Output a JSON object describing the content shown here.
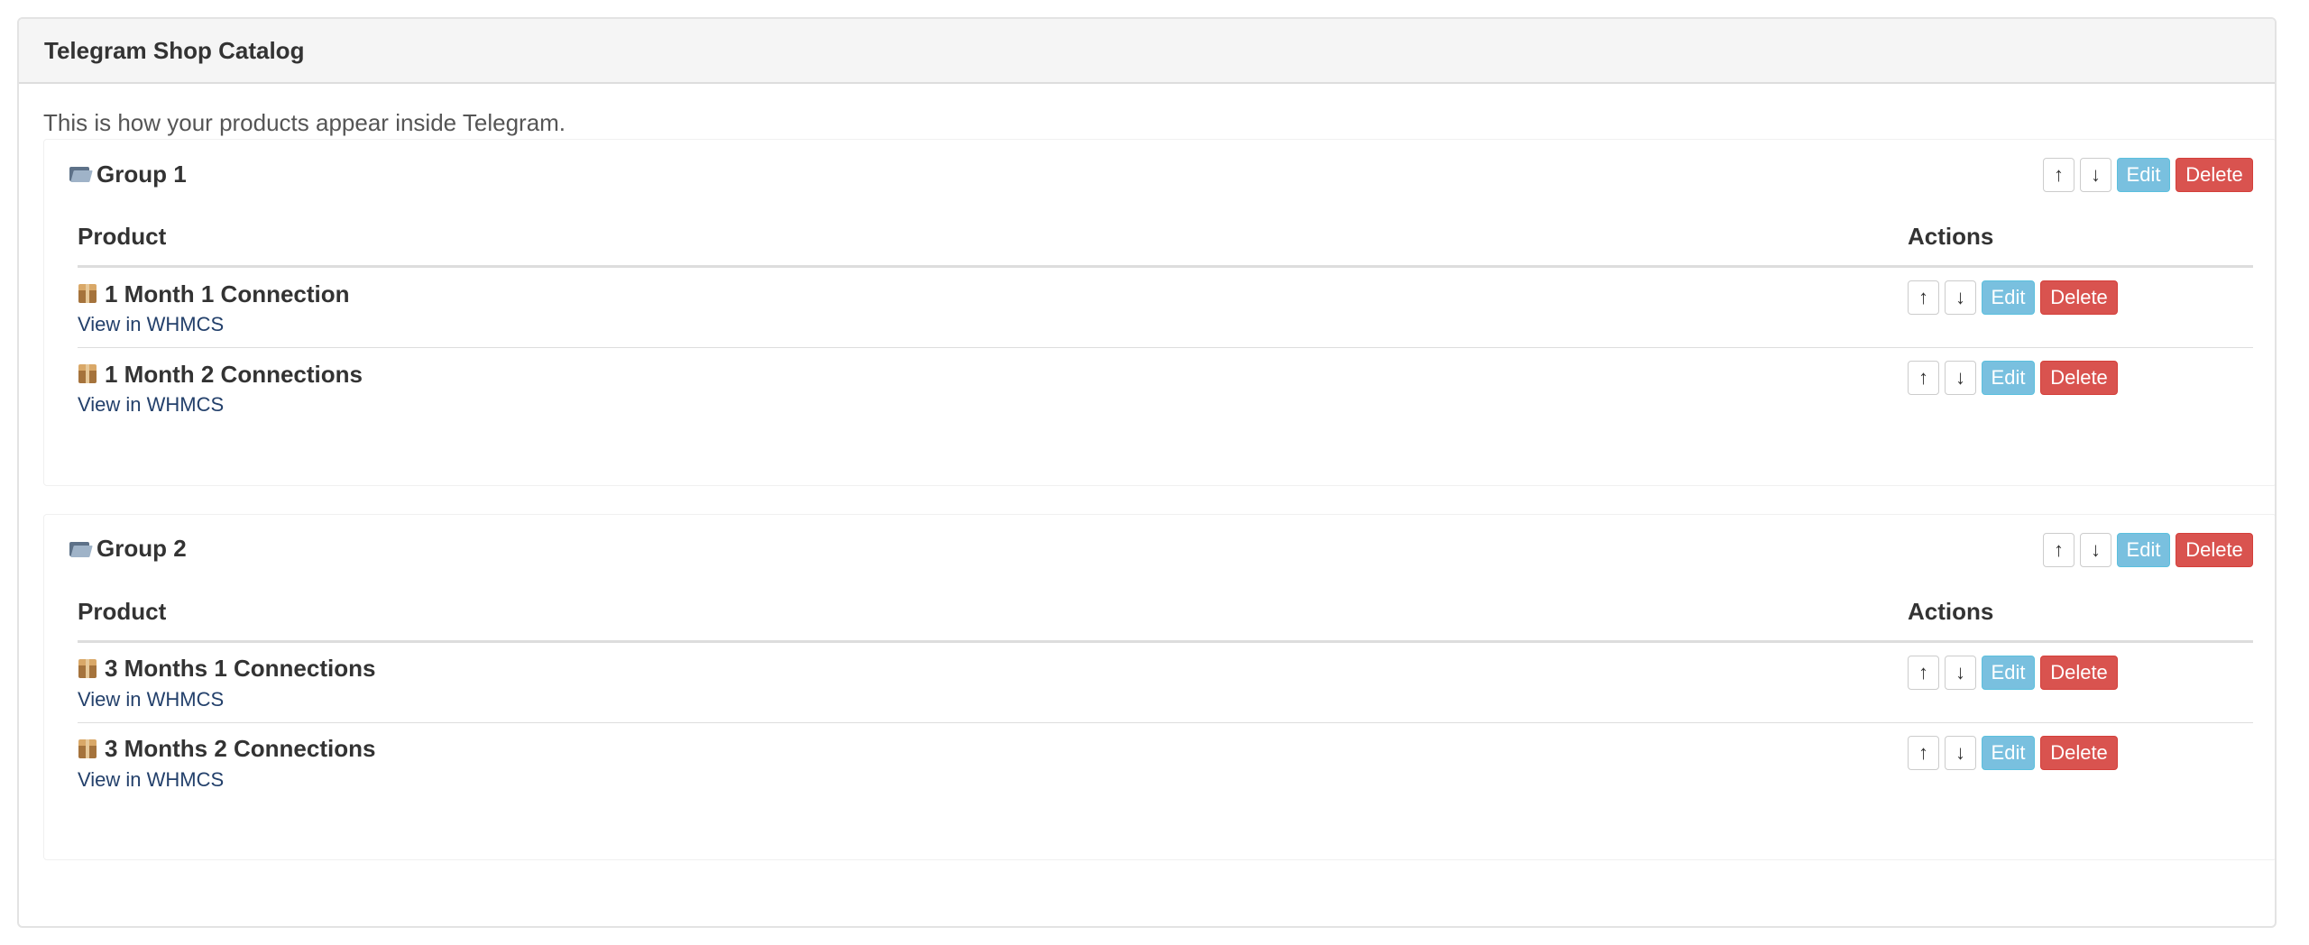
{
  "panel": {
    "title": "Telegram Shop Catalog",
    "intro": "This is how your products appear inside Telegram."
  },
  "labels": {
    "up": "↑",
    "down": "↓",
    "edit": "Edit",
    "delete": "Delete",
    "view_link": "View in WHMCS",
    "col_product": "Product",
    "col_actions": "Actions"
  },
  "groups": [
    {
      "name": "Group 1",
      "products": [
        {
          "name": "1 Month 1 Connection"
        },
        {
          "name": "1 Month 2 Connections"
        }
      ]
    },
    {
      "name": "Group 2",
      "products": [
        {
          "name": "3 Months 1 Connections"
        },
        {
          "name": "3 Months 2 Connections"
        }
      ]
    }
  ],
  "colors": {
    "edit": "#79c0df",
    "delete": "#d9534f",
    "link": "#23406b"
  },
  "icons": {
    "group": "folder-icon",
    "product": "package-icon"
  }
}
